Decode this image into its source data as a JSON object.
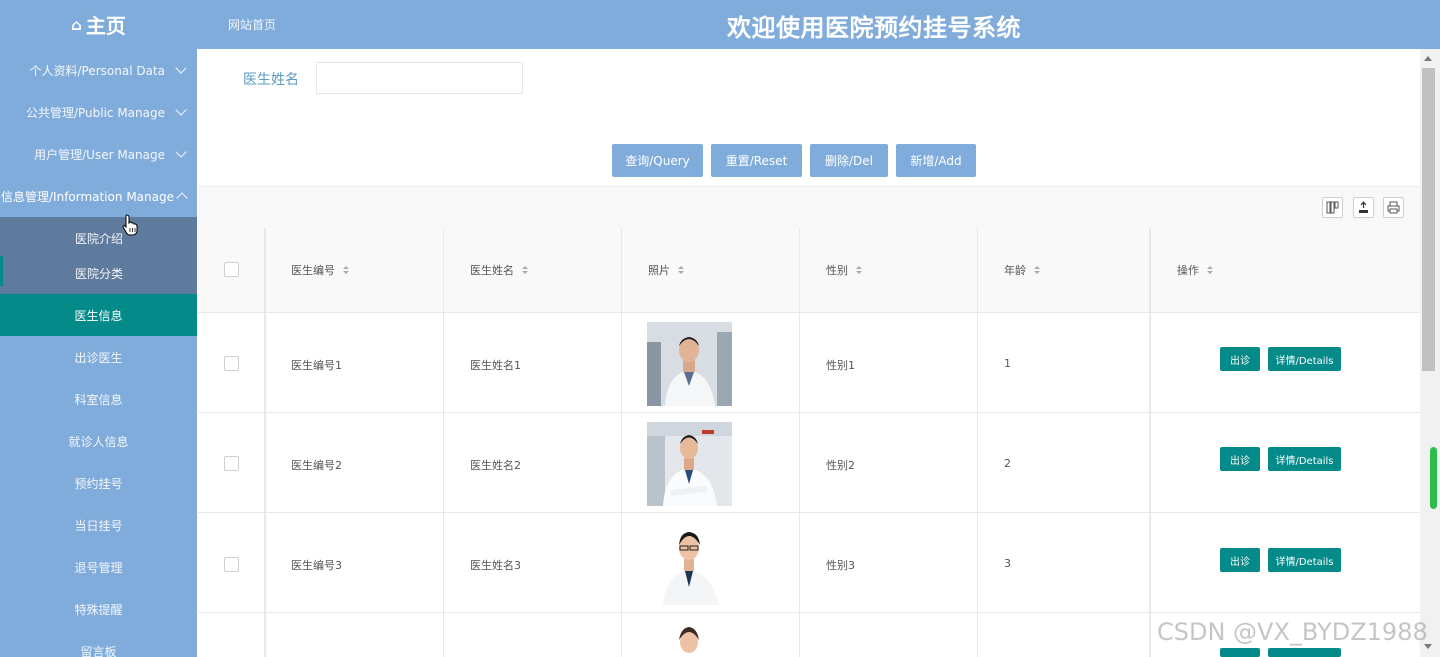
{
  "header": {
    "home_icon": "home-icon",
    "home_label": "主页",
    "site_link": "网站首页",
    "title": "欢迎使用医院预约挂号系统"
  },
  "sidebar": {
    "groups": [
      {
        "label": "个人资料/Personal Data"
      },
      {
        "label": "公共管理/Public Manage"
      },
      {
        "label": "用户管理/User Manage"
      },
      {
        "label": "信息管理/Information Manage"
      }
    ],
    "items": [
      {
        "label": "医院介绍"
      },
      {
        "label": "医院分类"
      },
      {
        "label": "医生信息"
      },
      {
        "label": "出诊医生"
      },
      {
        "label": "科室信息"
      },
      {
        "label": "就诊人信息"
      },
      {
        "label": "预约挂号"
      },
      {
        "label": "当日挂号"
      },
      {
        "label": "退号管理"
      },
      {
        "label": "特殊提醒"
      },
      {
        "label": "留言板"
      }
    ],
    "active_item": "医生信息"
  },
  "search": {
    "label": "医生姓名",
    "value": "",
    "placeholder": ""
  },
  "buttons": {
    "query": "查询/Query",
    "reset": "重置/Reset",
    "delete": "删除/Del",
    "add": "新增/Add"
  },
  "table": {
    "headers": [
      "医生编号",
      "医生姓名",
      "照片",
      "性别",
      "年龄",
      "操作"
    ],
    "rows": [
      {
        "id": "医生编号1",
        "name": "医生姓名1",
        "gender": "性别1",
        "age": "1",
        "visit": "出诊",
        "details": "详情/Details"
      },
      {
        "id": "医生编号2",
        "name": "医生姓名2",
        "gender": "性别2",
        "age": "2",
        "visit": "出诊",
        "details": "详情/Details"
      },
      {
        "id": "医生编号3",
        "name": "医生姓名3",
        "gender": "性别3",
        "age": "3",
        "visit": "出诊",
        "details": "详情/Details"
      }
    ]
  },
  "watermark": "CSDN @VX_BYDZ1988",
  "colors": {
    "primary_blue": "#80acdc",
    "teal": "#048a89",
    "dark_submenu": "#5e7a9c"
  }
}
